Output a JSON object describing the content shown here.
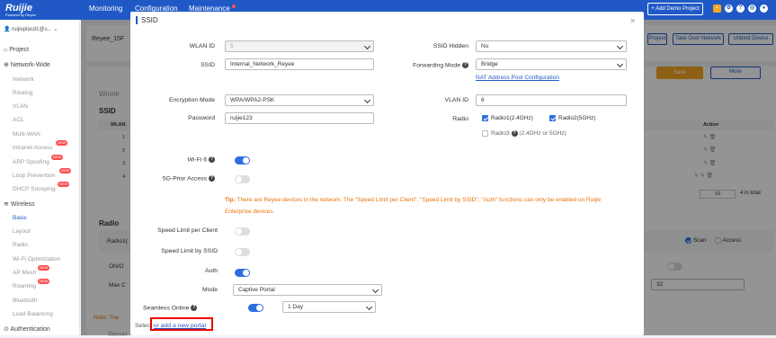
{
  "topbar": {
    "logo_text": "Ruijie",
    "logo_sub": "Powered by Reyee",
    "nav": [
      "Monitoring",
      "Configuration",
      "Maintenance"
    ],
    "add_demo_label": "+ Add Demo Project"
  },
  "sidebar": {
    "user": "ruijieplacd1@s...",
    "items": [
      {
        "label": "Project",
        "type": "group"
      },
      {
        "label": "Network-Wide",
        "type": "group"
      },
      {
        "label": "Network"
      },
      {
        "label": "Routing"
      },
      {
        "label": "VLAN"
      },
      {
        "label": "ACL"
      },
      {
        "label": "Multi-WAN"
      },
      {
        "label": "Intranet Access",
        "badge": "NEW"
      },
      {
        "label": "ARP Spoofing",
        "badge": "NEW"
      },
      {
        "label": "Loop Prevention",
        "badge": "NEW"
      },
      {
        "label": "DHCP Snooping",
        "badge": "NEW"
      },
      {
        "label": "Wireless",
        "type": "group"
      },
      {
        "label": "Basic",
        "active": true
      },
      {
        "label": "Layout"
      },
      {
        "label": "Radio"
      },
      {
        "label": "Wi-Fi Optimization"
      },
      {
        "label": "AP Mesh",
        "badge": "NEW"
      },
      {
        "label": "Roaming",
        "badge": "NEW"
      },
      {
        "label": "Bluetooth"
      },
      {
        "label": "Load Balancing"
      },
      {
        "label": "Authentication",
        "type": "group"
      }
    ]
  },
  "background": {
    "device": "Reyee_15F",
    "buttons": [
      "Project",
      "Take Over Network",
      "Unbind Device"
    ],
    "section_wireless": "Wirele",
    "ssid_header": "SSID",
    "wlan_col": "WLAN",
    "rows": [
      "1",
      "2",
      "3",
      "4"
    ],
    "action_col": "Action",
    "save": "Save",
    "more": "More",
    "page_size": "10",
    "total": "4 in total",
    "radio_section": "Radio",
    "radio_tab": "Radio1(",
    "onoff": "ON/O",
    "maxc": "Max C",
    "scan": "Scan",
    "access": "Access",
    "value_32": "32",
    "note": "Note: The",
    "security": "Securi"
  },
  "modal": {
    "title": "SSID",
    "close": "×",
    "wlan_id_label": "WLAN ID",
    "wlan_id_value": "5",
    "ssid_label": "SSID",
    "ssid_value": "Internal_Network_Reyee",
    "ssid_hidden_label": "SSID Hidden",
    "ssid_hidden_value": "No",
    "forwarding_label": "Forwarding Mode",
    "forwarding_value": "Bridge",
    "nat_link": "NAT Address Pool Configuration",
    "encryption_label": "Encryption Mode",
    "encryption_value": "WPA/WPA2-PSK",
    "password_label": "Password",
    "password_value": "ruijie123",
    "vlan_label": "VLAN ID",
    "vlan_value": "6",
    "radio_label": "Radio",
    "radio1": "Radio1(2.4GHz)",
    "radio2": "Radio2(5GHz)",
    "radio3": "Radio3",
    "radio3_note": "(2.4GHz or 5GHz)",
    "wifi6_label": "Wi-Fi 6",
    "fiveg_label": "5G-Prior Access",
    "tip_prefix": "Tip:",
    "tip_text": " There are Reyee devices in the network. The \"Speed Limit per Client\", \"Speed Limit by SSID\", \"Auth\" functions can only be enabled on Ruijie Enterprise devices.",
    "speed_client_label": "Speed Limit per Client",
    "speed_ssid_label": "Speed Limit by SSID",
    "auth_label": "Auth",
    "mode_label": "Mode",
    "mode_value": "Captive Portal",
    "seamless_label": "Seamless Online",
    "seamless_value": "1 Day",
    "select_prefix": "Select",
    "select_link": "or add a new portal"
  },
  "colors": {
    "brand": "#2059c6",
    "save": "#f5a623",
    "tip": "#e8730c",
    "highlight": "#e00000"
  }
}
